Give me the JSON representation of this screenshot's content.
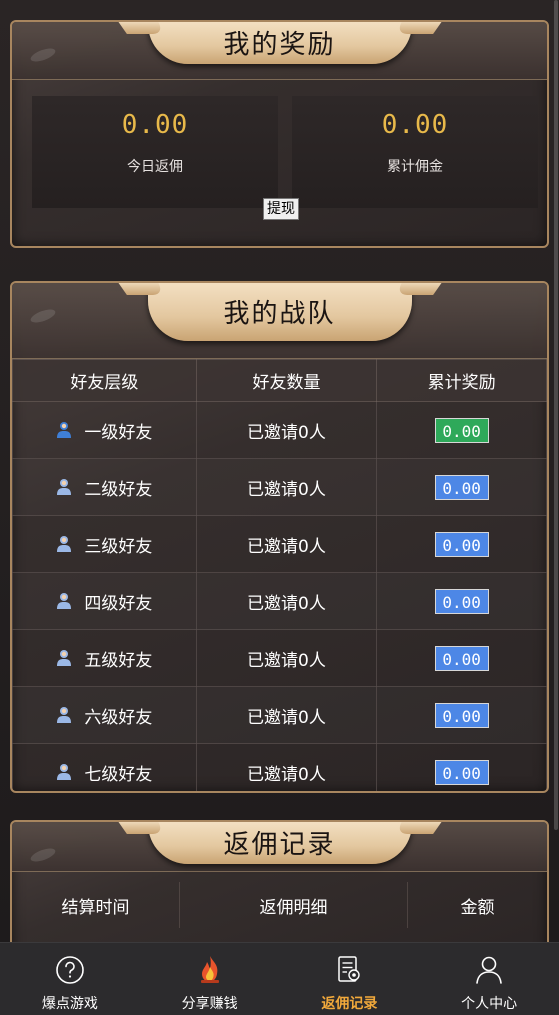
{
  "rewards": {
    "title": "我的奖励",
    "today_value": "0.00",
    "today_label": "今日返佣",
    "total_value": "0.00",
    "total_label": "累计佣金",
    "withdraw_label": "提现"
  },
  "team": {
    "title": "我的战队",
    "headers": [
      "好友层级",
      "好友数量",
      "累计奖励"
    ],
    "rows": [
      {
        "level": "一级好友",
        "count": "已邀请0人",
        "reward": "0.00",
        "status_color": "#2ea95a"
      },
      {
        "level": "二级好友",
        "count": "已邀请0人",
        "reward": "0.00",
        "status_color": "#4d87e6"
      },
      {
        "level": "三级好友",
        "count": "已邀请0人",
        "reward": "0.00",
        "status_color": "#4d87e6"
      },
      {
        "level": "四级好友",
        "count": "已邀请0人",
        "reward": "0.00",
        "status_color": "#4d87e6"
      },
      {
        "level": "五级好友",
        "count": "已邀请0人",
        "reward": "0.00",
        "status_color": "#4d87e6"
      },
      {
        "level": "六级好友",
        "count": "已邀请0人",
        "reward": "0.00",
        "status_color": "#4d87e6"
      },
      {
        "level": "七级好友",
        "count": "已邀请0人",
        "reward": "0.00",
        "status_color": "#4d87e6"
      }
    ]
  },
  "records": {
    "title": "返佣记录",
    "headers": [
      "结算时间",
      "返佣明细",
      "金额"
    ]
  },
  "nav": {
    "items": [
      {
        "label": "爆点游戏",
        "icon": "question-circle-icon"
      },
      {
        "label": "分享赚钱",
        "icon": "flame-icon"
      },
      {
        "label": "返佣记录",
        "icon": "record-document-icon"
      },
      {
        "label": "个人中心",
        "icon": "user-profile-icon"
      }
    ],
    "active_index": 2,
    "active_color": "#f2a93b"
  },
  "colors": {
    "gold_value": "#e8b94a",
    "ribbon": "#e3c79f",
    "panel_border": "#a8865f"
  }
}
